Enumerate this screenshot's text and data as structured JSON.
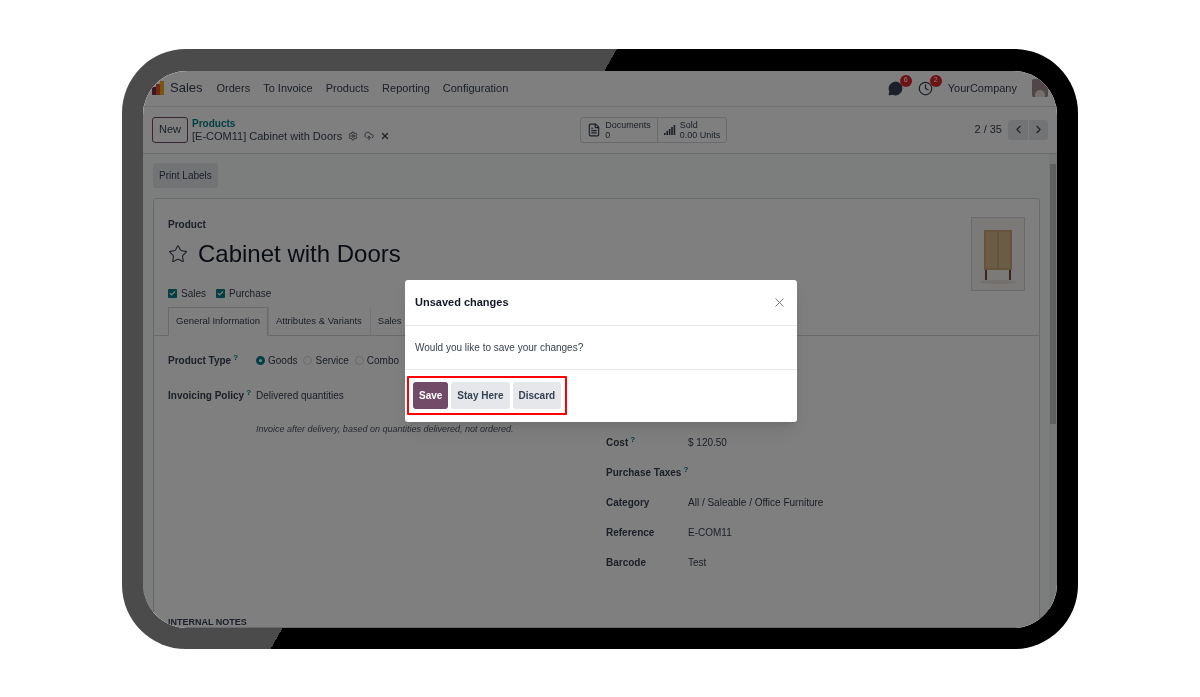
{
  "navbar": {
    "app_name": "Sales",
    "menu": [
      "Orders",
      "To Invoice",
      "Products",
      "Reporting",
      "Configuration"
    ],
    "systray": [
      {
        "kind": "messages",
        "badge": "6"
      },
      {
        "kind": "activities",
        "badge": "2"
      }
    ],
    "company": "YourCompany"
  },
  "control_panel": {
    "new_button": "New",
    "breadcrumb": "Products",
    "record": "[E-COM11] Cabinet with Doors",
    "stat_buttons": [
      {
        "kind": "documents",
        "label": "Documents",
        "value": "0"
      },
      {
        "kind": "sold",
        "label": "Sold",
        "value": "0.00 Units"
      }
    ],
    "pager": "2 / 35"
  },
  "action_buttons": [
    "Print Labels"
  ],
  "form": {
    "label": "Product",
    "name": "Cabinet with Doors",
    "favorite": false,
    "options": [
      {
        "label": "Sales",
        "checked": true
      },
      {
        "label": "Purchase",
        "checked": true
      }
    ],
    "tabs": [
      {
        "label": "General Information",
        "selected": true
      },
      {
        "label": "Attributes & Variants",
        "selected": false
      },
      {
        "label": "Sales",
        "selected": false
      }
    ],
    "left_fields": [
      {
        "kind": "radio",
        "label": "Product Type",
        "tooltip": "?",
        "choices": [
          {
            "label": "Goods",
            "selected": true
          },
          {
            "label": "Service",
            "selected": false
          },
          {
            "label": "Combo",
            "selected": false
          }
        ]
      },
      {
        "kind": "text",
        "label": "Invoicing Policy",
        "tooltip": "?",
        "value": "Delivered quantities",
        "hint": "Invoice after delivery, based on quantities delivered, not ordered."
      }
    ],
    "right_fields": [
      {
        "label": "Cost",
        "tooltip": "?",
        "value": "$ 120.50"
      },
      {
        "label": "Purchase Taxes",
        "tooltip": "?"
      },
      {
        "label": "Category",
        "value": "All / Saleable / Office Furniture"
      },
      {
        "label": "Reference",
        "value": "E-COM11"
      },
      {
        "label": "Barcode",
        "value": "Test"
      }
    ],
    "section": "INTERNAL NOTES"
  },
  "dialog": {
    "title": "Unsaved changes",
    "body": "Would you like to save your changes?",
    "highlighted": true,
    "buttons": [
      {
        "label": "Save",
        "kind": "primary"
      },
      {
        "label": "Stay Here",
        "kind": "secondary"
      },
      {
        "label": "Discard",
        "kind": "secondary"
      }
    ]
  }
}
